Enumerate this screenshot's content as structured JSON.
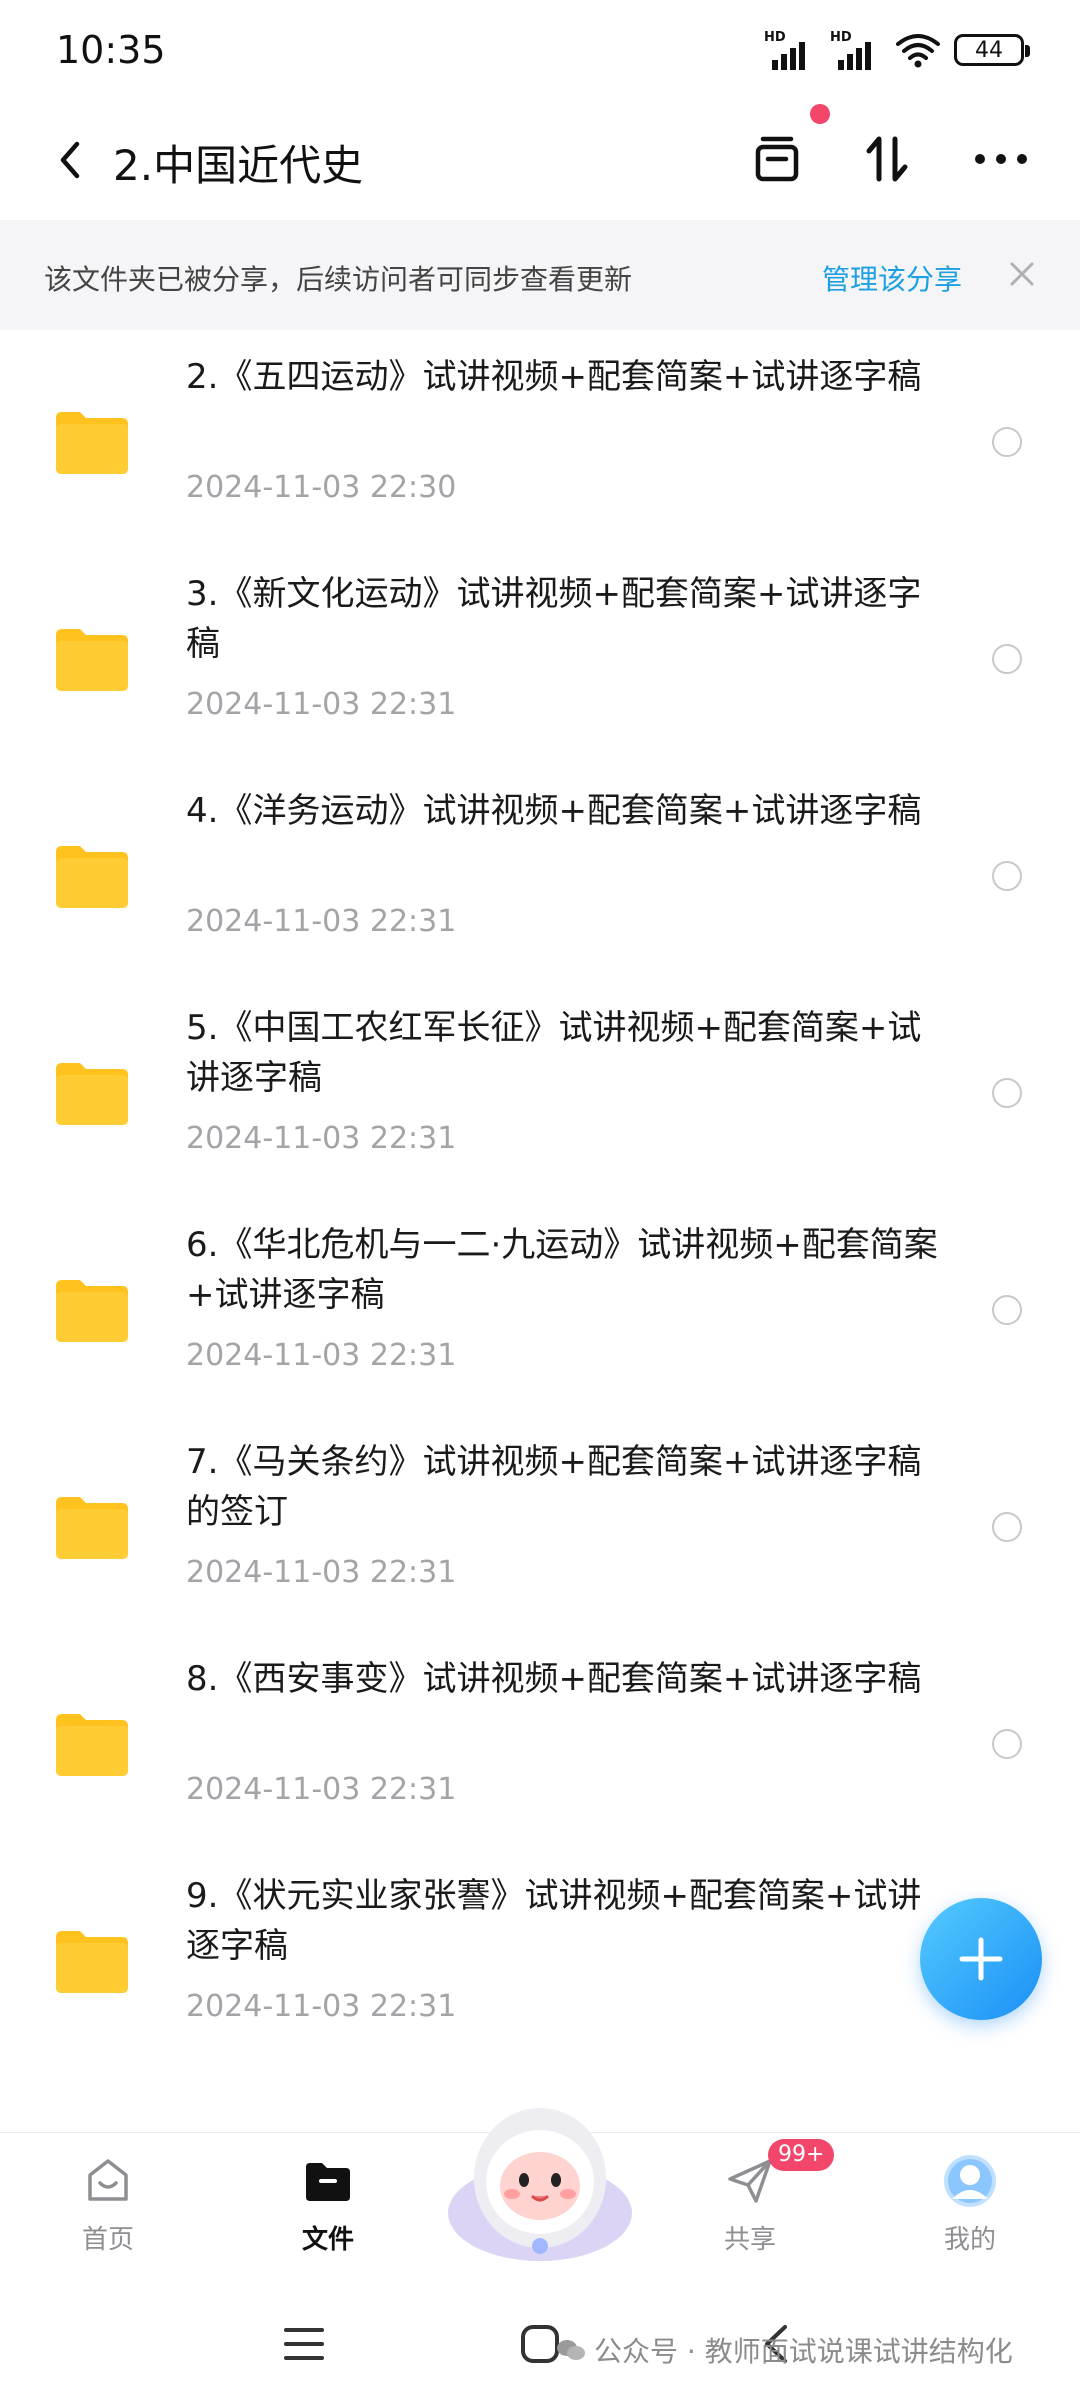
{
  "status_bar": {
    "time": "10:35",
    "signal_label": "HD",
    "battery": "44"
  },
  "header": {
    "title": "2.中国近代史"
  },
  "banner": {
    "text": "该文件夹已被分享，后续访问者可同步查看更新",
    "link": "管理该分享"
  },
  "files": [
    {
      "name": "2.《五四运动》试讲视频+配套简案+试讲逐字稿",
      "date": "2024-11-03  22:30"
    },
    {
      "name": "3.《新文化运动》试讲视频+配套简案+试讲逐字稿",
      "date": "2024-11-03  22:31"
    },
    {
      "name": "4.《洋务运动》试讲视频+配套简案+试讲逐字稿",
      "date": "2024-11-03  22:31"
    },
    {
      "name": "5.《中国工农红军长征》试讲视频+配套简案+试讲逐字稿",
      "date": "2024-11-03  22:31"
    },
    {
      "name": "6.《华北危机与一二·九运动》试讲视频+配套简案+试讲逐字稿",
      "date": "2024-11-03  22:31"
    },
    {
      "name": "7.《马关条约》试讲视频+配套简案+试讲逐字稿的签订",
      "date": "2024-11-03  22:31"
    },
    {
      "name": "8.《西安事变》试讲视频+配套简案+试讲逐字稿",
      "date": "2024-11-03  22:31"
    },
    {
      "name": "9.《状元实业家张謇》试讲视频+配套简案+试讲逐字稿",
      "date": "2024-11-03  22:31"
    }
  ],
  "bottom_nav": {
    "home": "首页",
    "files": "文件",
    "share": "共享",
    "share_badge": "99+",
    "mine": "我的"
  },
  "watermark": "公众号 · 教师面试说课试讲结构化",
  "colors": {
    "accent": "#1ba0e1",
    "badge": "#f2466b",
    "folder": "#ffcc33",
    "date_gray": "#a3a3a8"
  },
  "icons": [
    "back-icon",
    "archive-icon",
    "sort-icon",
    "more-icon",
    "close-icon",
    "folder-icon",
    "plus-icon",
    "home-icon",
    "files-icon",
    "share-icon",
    "profile-icon",
    "menu-icon",
    "square-icon",
    "back-nav-icon"
  ]
}
